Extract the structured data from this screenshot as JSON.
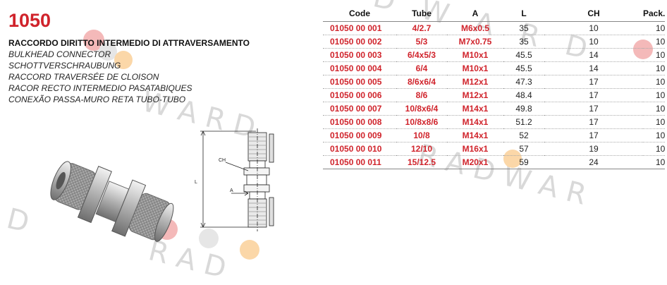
{
  "product": {
    "code": "1050",
    "title": "RACCORDO DIRITTO INTERMEDIO DI ATTRAVERSAMENTO",
    "translations": [
      "BULKHEAD CONNECTOR",
      "SCHOTTVERSCHRAUBUNG",
      "RACCORD TRAVERSÉE DE CLOISON",
      "RACOR RECTO INTERMEDIO PASATABIQUES",
      "CONEXÃO PASSA-MURO RETA TUBO-TUBO"
    ]
  },
  "drawing": {
    "label_ch": "CH",
    "label_a": "A",
    "label_l": "L"
  },
  "watermark": {
    "text": "RADWAR"
  },
  "colors": {
    "accent": "#d0232b",
    "watermark": "#d9d9d9",
    "dot_red": "#f4b9b9",
    "dot_orange": "#fbd7a8",
    "dot_grey": "#dddddd"
  },
  "table": {
    "headers": [
      "Code",
      "Tube",
      "A",
      "L",
      "CH",
      "Pack."
    ],
    "rows": [
      [
        "01050 00 001",
        "4/2.7",
        "M6x0.5",
        "35",
        "10",
        "10"
      ],
      [
        "01050 00 002",
        "5/3",
        "M7x0.75",
        "35",
        "10",
        "10"
      ],
      [
        "01050 00 003",
        "6/4x5/3",
        "M10x1",
        "45.5",
        "14",
        "10"
      ],
      [
        "01050 00 004",
        "6/4",
        "M10x1",
        "45.5",
        "14",
        "10"
      ],
      [
        "01050 00 005",
        "8/6x6/4",
        "M12x1",
        "47.3",
        "17",
        "10"
      ],
      [
        "01050 00 006",
        "8/6",
        "M12x1",
        "48.4",
        "17",
        "10"
      ],
      [
        "01050 00 007",
        "10/8x6/4",
        "M14x1",
        "49.8",
        "17",
        "10"
      ],
      [
        "01050 00 008",
        "10/8x8/6",
        "M14x1",
        "51.2",
        "17",
        "10"
      ],
      [
        "01050 00 009",
        "10/8",
        "M14x1",
        "52",
        "17",
        "10"
      ],
      [
        "01050 00 010",
        "12/10",
        "M16x1",
        "57",
        "19",
        "10"
      ],
      [
        "01050 00 011",
        "15/12.5",
        "M20x1",
        "59",
        "24",
        "10"
      ]
    ]
  }
}
